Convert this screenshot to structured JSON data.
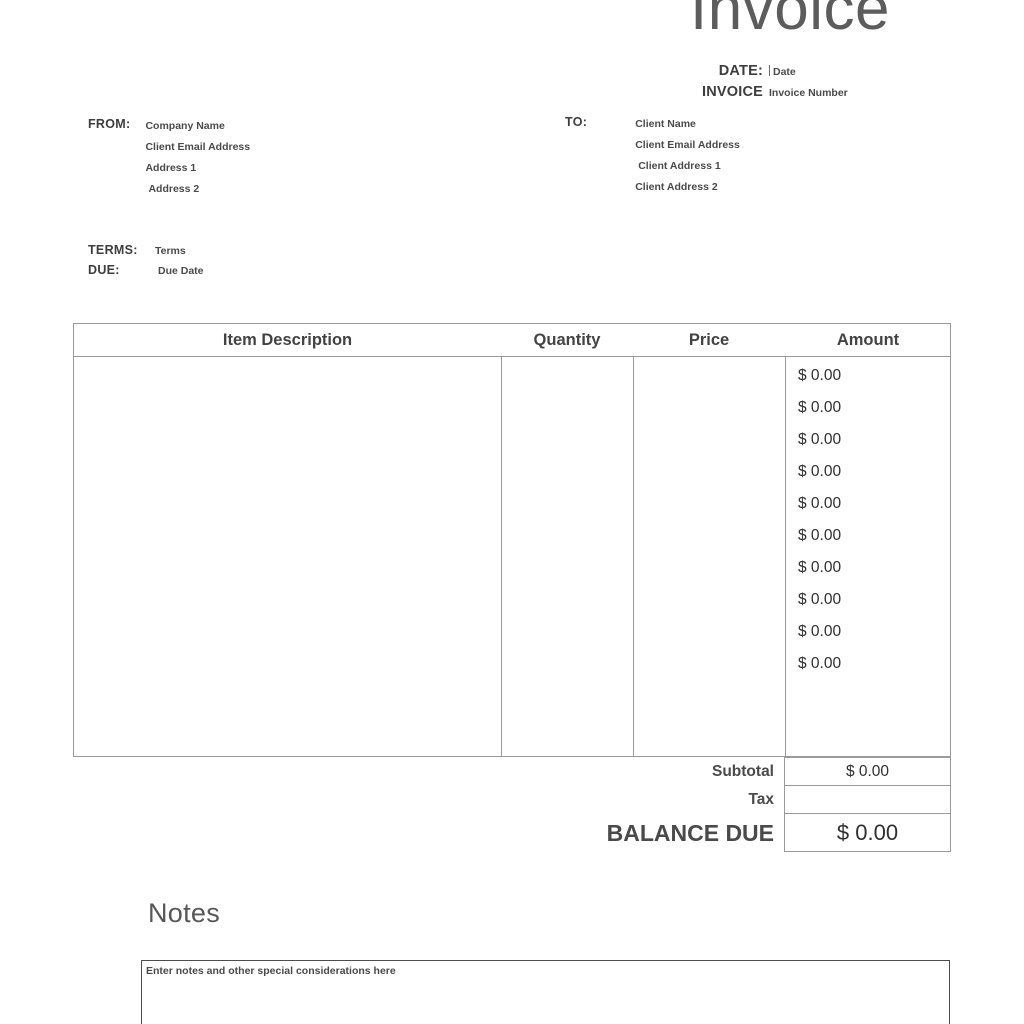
{
  "document": {
    "title": "Invoice"
  },
  "meta": {
    "date_label": "DATE:",
    "date_value": "Date",
    "invoice_label": "INVOICE",
    "invoice_value": "Invoice Number"
  },
  "from": {
    "label": "FROM:",
    "lines": [
      "Company Name",
      "Client Email Address",
      "Address 1",
      "Address 2"
    ]
  },
  "to": {
    "label": "TO:",
    "lines": [
      "Client Name",
      "Client Email Address",
      "Client Address 1",
      "Client Address 2"
    ]
  },
  "terms": {
    "terms_label": "TERMS:",
    "terms_value": "Terms",
    "due_label": "DUE:",
    "due_value": "Due Date"
  },
  "items_table": {
    "columns": [
      "Item Description",
      "Quantity",
      "Price",
      "Amount"
    ],
    "rows": [
      {
        "description": "",
        "quantity": "",
        "price": "",
        "amount": "$ 0.00"
      },
      {
        "description": "",
        "quantity": "",
        "price": "",
        "amount": "$ 0.00"
      },
      {
        "description": "",
        "quantity": "",
        "price": "",
        "amount": "$ 0.00"
      },
      {
        "description": "",
        "quantity": "",
        "price": "",
        "amount": "$ 0.00"
      },
      {
        "description": "",
        "quantity": "",
        "price": "",
        "amount": "$ 0.00"
      },
      {
        "description": "",
        "quantity": "",
        "price": "",
        "amount": "$ 0.00"
      },
      {
        "description": "",
        "quantity": "",
        "price": "",
        "amount": "$ 0.00"
      },
      {
        "description": "",
        "quantity": "",
        "price": "",
        "amount": "$ 0.00"
      },
      {
        "description": "",
        "quantity": "",
        "price": "",
        "amount": "$ 0.00"
      },
      {
        "description": "",
        "quantity": "",
        "price": "",
        "amount": "$ 0.00"
      }
    ]
  },
  "totals": {
    "subtotal_label": "Subtotal",
    "subtotal_value": "$ 0.00",
    "tax_label": "Tax",
    "tax_value": "",
    "balance_label": "BALANCE DUE",
    "balance_value": "$ 0.00"
  },
  "notes": {
    "heading": "Notes",
    "placeholder": "Enter notes and other special considerations here"
  },
  "colors": {
    "text": "#3b3b3b",
    "heading_gray": "#5c5c5c",
    "border": "#9a9a9a",
    "notes_border": "#4d4d4d",
    "background": "#ffffff"
  }
}
